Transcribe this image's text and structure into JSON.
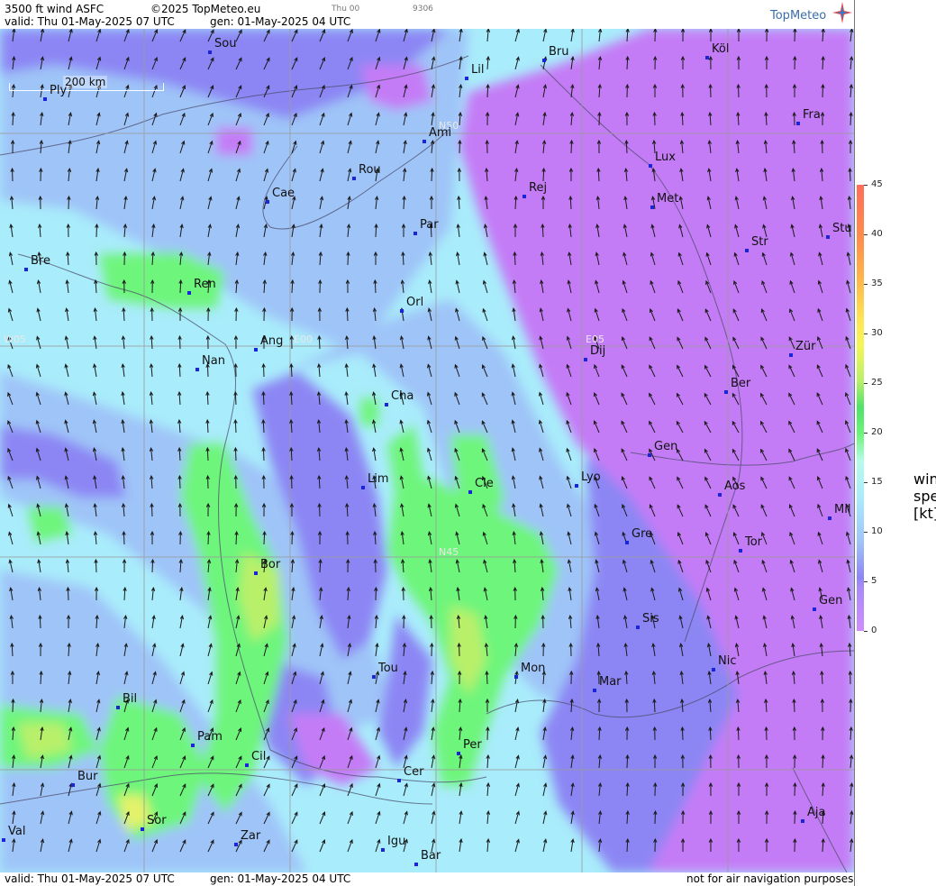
{
  "header": {
    "product": "3500 ft wind ASFC",
    "copyright": "©2025 TopMeteo.eu",
    "day": "Thu 00",
    "code": "9306",
    "valid": "valid:  Thu  01-May-2025  07 UTC",
    "gen": "gen:  01-May-2025 04 UTC",
    "logo": "TopMeteo"
  },
  "footer": {
    "valid": "valid:  Thu  01-May-2025  07 UTC",
    "gen": "gen:  01-May-2025 04 UTC",
    "disclaimer": "not for air navigation purposes"
  },
  "scale_bar": {
    "label": "200 km"
  },
  "grid_labels": [
    "N50",
    "N45",
    "W05",
    "E00",
    "E05"
  ],
  "cities": [
    "Sou",
    "Lil",
    "Bru",
    "Köl",
    "Ply",
    "Ami",
    "Fra",
    "Lux",
    "Rou",
    "Cae",
    "Rej",
    "Met",
    "Par",
    "Stu",
    "Bre",
    "Str",
    "Ren",
    "Orl",
    "Ang",
    "E00",
    "Dij",
    "Zür",
    "Nan",
    "Ber",
    "Cha",
    "Gen",
    "Lim",
    "Cle",
    "Lyo",
    "Aos",
    "Mil",
    "Tor",
    "Gre",
    "Bor",
    "Gen",
    "Sis",
    "Tou",
    "Nic",
    "Mon",
    "Mar",
    "Bil",
    "Pam",
    "Cil",
    "Per",
    "Bur",
    "Cer",
    "Sor",
    "Aja",
    "Zar",
    "Igu",
    "Val",
    "Bar"
  ],
  "legend": {
    "unit": "wind speed [kt]",
    "ticks": [
      "45",
      "40",
      "35",
      "30",
      "25",
      "20",
      "15",
      "10",
      "5",
      "0"
    ],
    "colors": {
      "0": "#d08cff",
      "5": "#8c86f4",
      "10": "#9fc4f8",
      "15": "#a9ecfb",
      "20": "#b6fbea",
      "25": "#4ee36a",
      "30": "#f4f655",
      "35": "#ffe456",
      "40": "#ffba4a",
      "45": "#ff6e5a"
    }
  }
}
